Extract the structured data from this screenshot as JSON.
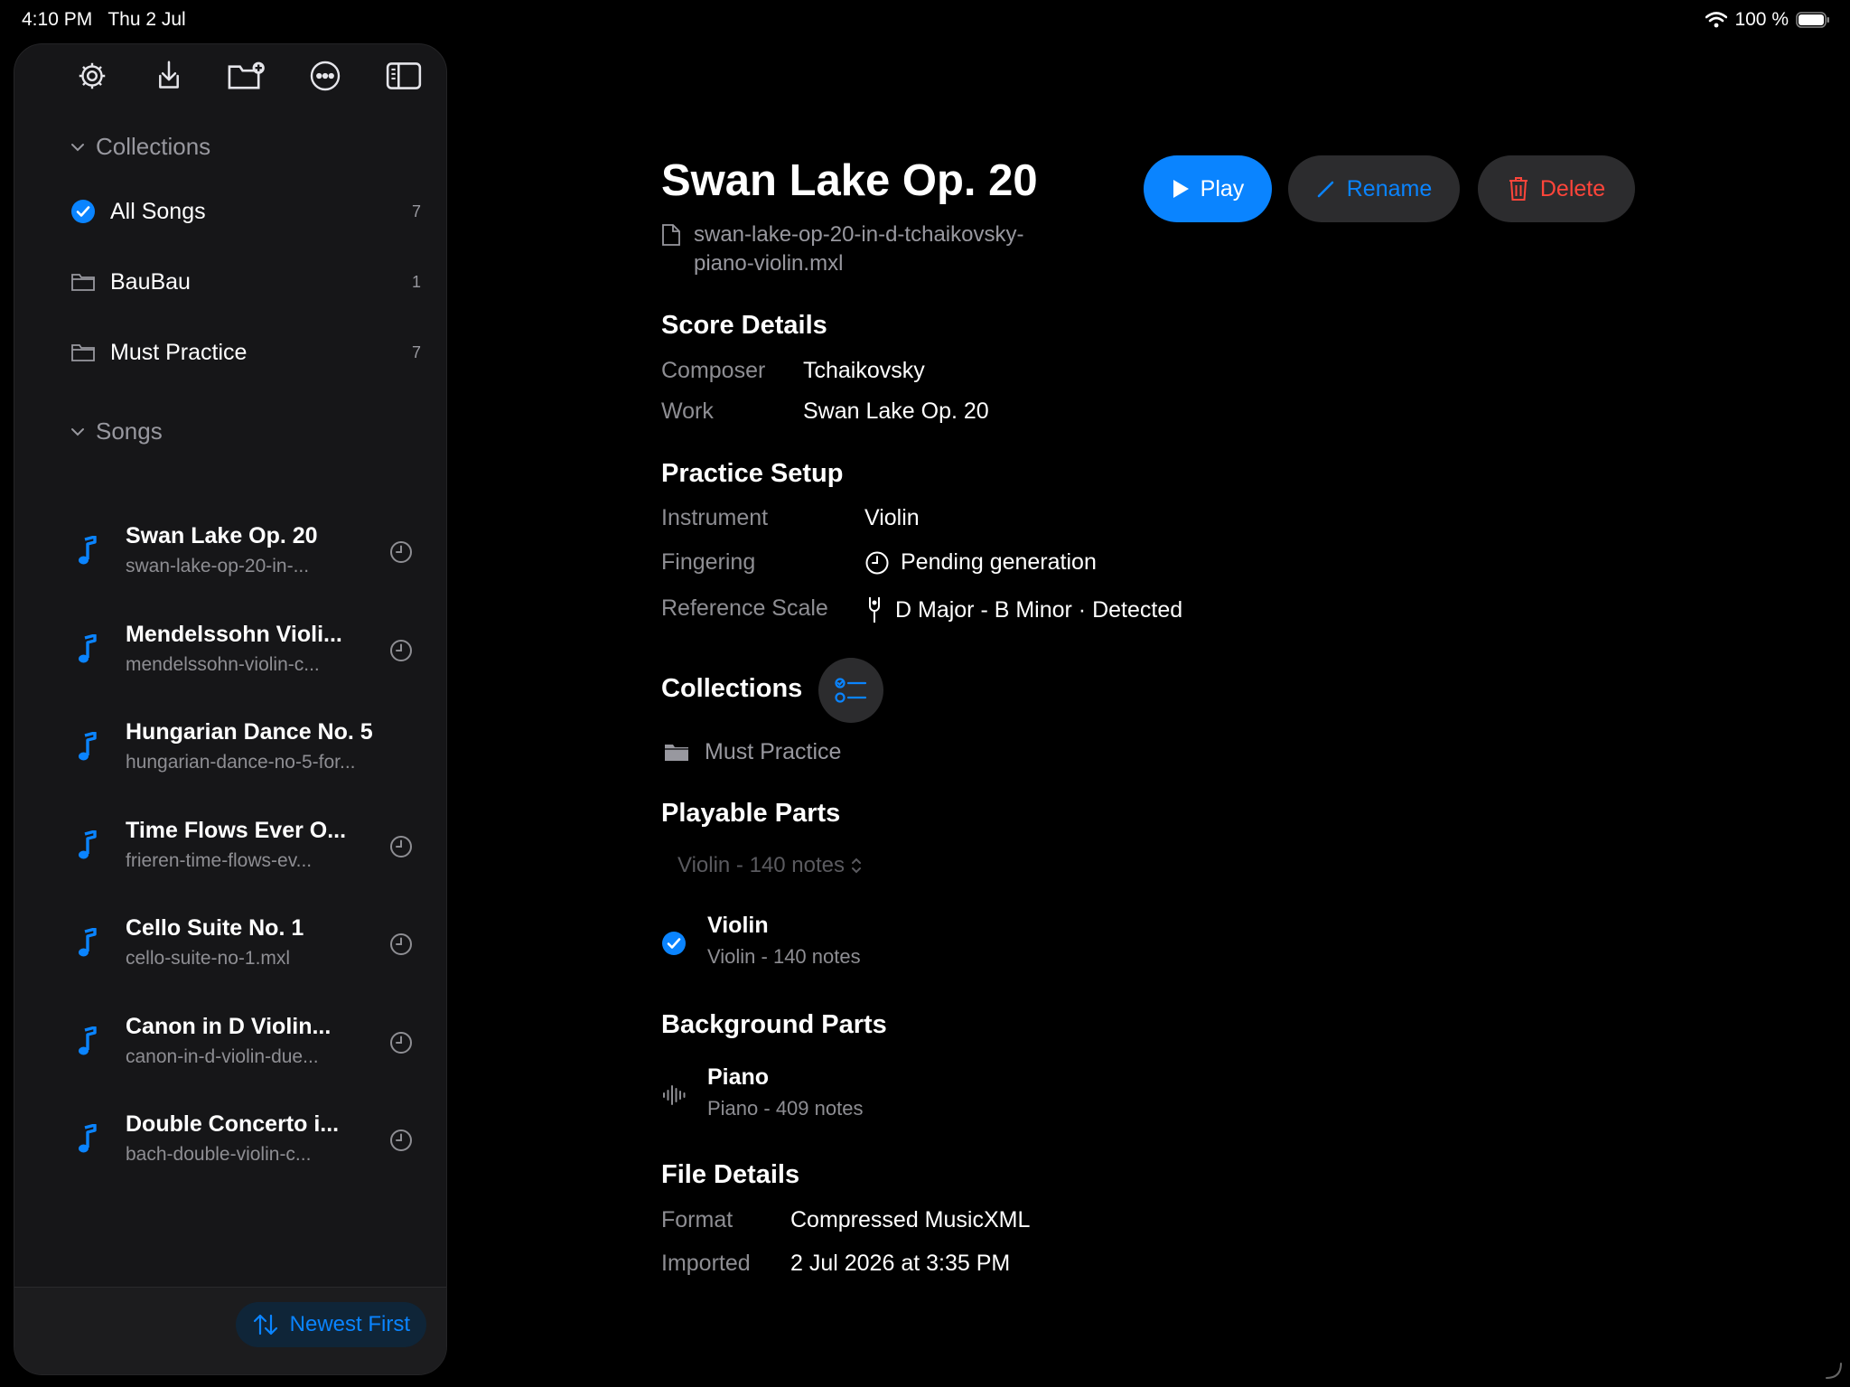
{
  "status_bar": {
    "time": "4:10 PM",
    "date": "Thu 2 Jul",
    "battery": "100 %"
  },
  "sidebar": {
    "collections_header": "Collections",
    "collections": [
      {
        "label": "All Songs",
        "count": "7",
        "icon": "checkmark-circle-icon",
        "selected": true
      },
      {
        "label": "BauBau",
        "count": "1",
        "icon": "folder-icon"
      },
      {
        "label": "Must Practice",
        "count": "7",
        "icon": "folder-icon"
      }
    ],
    "songs_header": "Songs",
    "songs": [
      {
        "title": "Swan Lake Op. 20",
        "file": "swan-lake-op-20-in-...",
        "pending": true
      },
      {
        "title": "Mendelssohn Violi...",
        "file": "mendelssohn-violin-c...",
        "pending": true
      },
      {
        "title": "Hungarian Dance No. 5",
        "file": "hungarian-dance-no-5-for...",
        "pending": false
      },
      {
        "title": "Time Flows Ever O...",
        "file": "frieren-time-flows-ev...",
        "pending": true
      },
      {
        "title": "Cello Suite No. 1",
        "file": "cello-suite-no-1.mxl",
        "pending": true
      },
      {
        "title": "Canon in D Violin...",
        "file": "canon-in-d-violin-due...",
        "pending": true
      },
      {
        "title": "Double Concerto i...",
        "file": "bach-double-violin-c...",
        "pending": true
      }
    ],
    "sort_label": "Newest First"
  },
  "detail": {
    "title": "Swan Lake Op. 20",
    "filename_line1": "swan-lake-op-20-in-d-tchaikovsky-",
    "filename_line2": "piano-violin.mxl",
    "buttons": {
      "play": "Play",
      "rename": "Rename",
      "delete": "Delete"
    },
    "score_details": {
      "heading": "Score Details",
      "composer_label": "Composer",
      "composer": "Tchaikovsky",
      "work_label": "Work",
      "work": "Swan Lake Op. 20"
    },
    "practice_setup": {
      "heading": "Practice Setup",
      "instrument_label": "Instrument",
      "instrument": "Violin",
      "fingering_label": "Fingering",
      "fingering": "Pending generation",
      "scale_label": "Reference Scale",
      "scale": "D Major - B Minor · Detected"
    },
    "collections": {
      "heading": "Collections",
      "item": "Must Practice"
    },
    "playable_parts": {
      "heading": "Playable Parts",
      "picker": "Violin - 140 notes",
      "part_name": "Violin",
      "part_detail": "Violin - 140 notes"
    },
    "background_parts": {
      "heading": "Background Parts",
      "part_name": "Piano",
      "part_detail": "Piano - 409 notes"
    },
    "file_details": {
      "heading": "File Details",
      "format_label": "Format",
      "format": "Compressed MusicXML",
      "imported_label": "Imported",
      "imported": "2 Jul 2026 at 3:35 PM"
    }
  },
  "colors": {
    "accent": "#0a84ff",
    "destructive": "#ff453a",
    "sidebar_bg": "#161618"
  }
}
